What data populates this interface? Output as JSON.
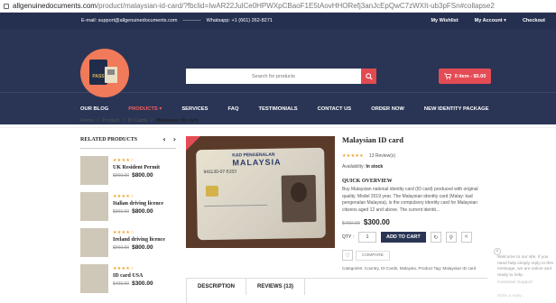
{
  "browser": {
    "url_host": "allgenuinedocuments.com",
    "url_path": "/product/malaysian-id-card/?fbclid=IwAR22JulCe0HPWXpCBaoF1E5tAovHHORefj3anJcEpQwC7zWXIt-ub3pFSn#collapse2"
  },
  "topbar": {
    "email": "E-mail: support@allgenuinedocuments.com",
    "separator": "-----------",
    "whatsapp": "Whatsapp: +1 (661) 262-8271",
    "wishlist": "My Wishlist",
    "account": "My Account",
    "checkout": "Checkout"
  },
  "logo": {
    "text": "PASS"
  },
  "search": {
    "placeholder": "Search for products"
  },
  "cart": {
    "label": "0 item - $0.00"
  },
  "nav": [
    "OUR BLOG",
    "PRODUCTS",
    "SERVICES",
    "FAQ",
    "TESTIMONIALS",
    "CONTACT US",
    "ORDER NOW",
    "NEW IDENTITY PACKAGE"
  ],
  "nav_active_index": 1,
  "breadcrumb": {
    "home": "Home",
    "product": "Product",
    "category": "ID Cards",
    "current": "Malaysian ID card",
    "sep": "/"
  },
  "related": {
    "heading": "RELATED PRODUCTS",
    "prev": "‹",
    "next": "›",
    "items": [
      {
        "name": "UK Resident Permit",
        "old": "$900.00",
        "new": "$800.00",
        "stars": "★★★★☆"
      },
      {
        "name": "Italian driving licence",
        "old": "$900.00",
        "new": "$800.00",
        "stars": "★★★★☆"
      },
      {
        "name": "Ireland driving licence",
        "old": "$900.00",
        "new": "$800.00",
        "stars": "★★★★☆"
      },
      {
        "name": "ID card USA",
        "old": "$400.00",
        "new": "$300.00",
        "stars": "★★★★☆"
      }
    ]
  },
  "product_image": {
    "card_line1": "KAD PENGENALAN",
    "card_line2": "MALAYSIA",
    "card_number": "941130-07-5153"
  },
  "product": {
    "title": "Malaysian ID card",
    "stars": "★★★★★",
    "reviews": "13 Review(s)",
    "availability_label": "Availability:",
    "availability_value": "In stock",
    "overview_heading": "QUICK OVERVIEW",
    "description": "Buy Malaysian national identity card (ID card) produced with original quality. Model 2019 year. The Malaysian identity card (Malay: kad pengenalan Malaysia), is the compulsory identity card for Malaysian citizens aged 12 and above. The current identit...",
    "old_price": "$400.00",
    "new_price": "$300.00",
    "qty_label": "QTY :",
    "qty_value": "1",
    "add_to_cart": "ADD TO CART",
    "compare": "COMPARE",
    "categories": "Categories: Country, ID Cards, Malaysia, Product Tag: Malaysian ID card"
  },
  "tabs": [
    "DESCRIPTION",
    "REVIEWS (13)"
  ],
  "chat": {
    "message": "Welcome to our site, if you need help simply reply to this message, we are online and ready to help.",
    "who": "Customer Support",
    "reply_placeholder": "Write a reply..."
  }
}
